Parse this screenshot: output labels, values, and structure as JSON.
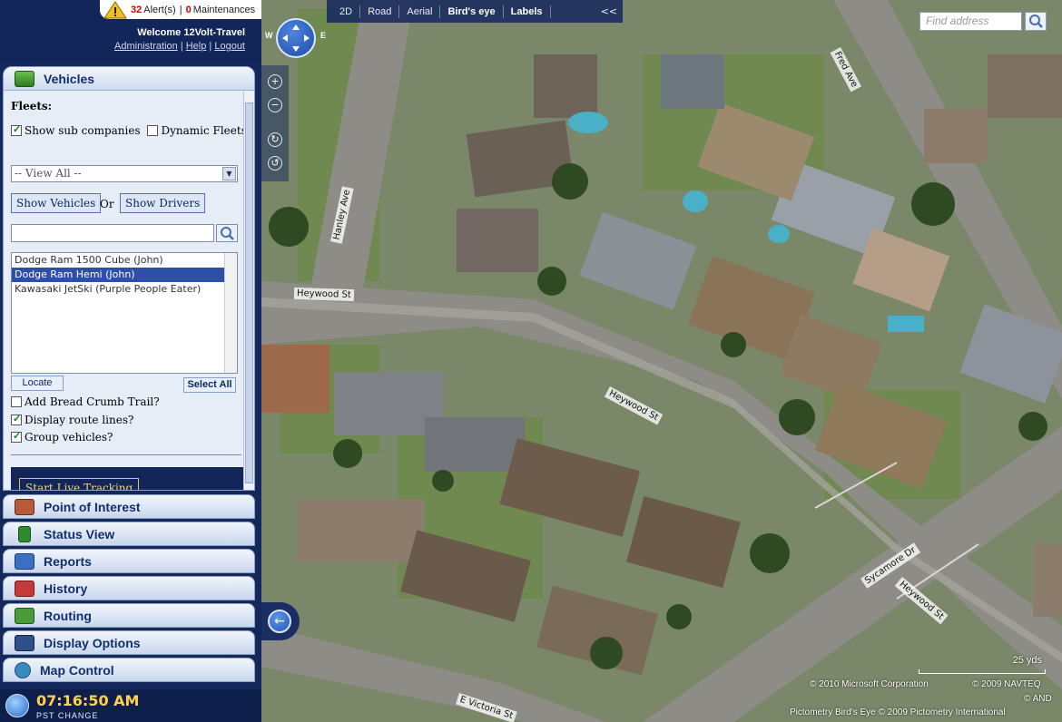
{
  "header": {
    "alert_count": "32",
    "alert_label": "Alert(s)",
    "separator": "|",
    "maintenance_count": "0",
    "maintenance_label": "Maintenances",
    "welcome": "Welcome 12Volt-Travel",
    "links": [
      "Administration",
      "Help",
      "Logout"
    ]
  },
  "vehicles_panel": {
    "title": "Vehicles",
    "fleets_label": "Fleets:",
    "show_sub_companies": {
      "label": "Show sub companies",
      "checked": true
    },
    "dynamic_fleets": {
      "label": "Dynamic Fleets",
      "checked": false
    },
    "fleet_select_value": "-- View All --",
    "show_vehicles_label": "Show Vehicles",
    "or_label": "Or",
    "show_drivers_label": "Show Drivers",
    "search_value": "",
    "vehicles": [
      {
        "name": "Dodge Ram 1500 Cube (John)",
        "selected": false
      },
      {
        "name": "Dodge Ram Hemi (John)",
        "selected": true
      },
      {
        "name": "Kawasaki JetSki (Purple People Eater)",
        "selected": false
      }
    ],
    "locate_label": "Locate",
    "select_all_label": "Select All",
    "options": [
      {
        "label": "Add Bread Crumb Trail?",
        "checked": false
      },
      {
        "label": "Display route lines?",
        "checked": true
      },
      {
        "label": "Group vehicles?",
        "checked": true
      }
    ],
    "live_tracking_label": "Start Live Tracking"
  },
  "nav_sections": [
    {
      "label": "Point of Interest",
      "icon": "house-icon",
      "color": "#b65a3a"
    },
    {
      "label": "Status View",
      "icon": "traffic-light-icon",
      "color": "#2d8a2d"
    },
    {
      "label": "Reports",
      "icon": "chart-icon",
      "color": "#3a6fc2"
    },
    {
      "label": "History",
      "icon": "calendar-icon",
      "color": "#c23a3a"
    },
    {
      "label": "Routing",
      "icon": "route-icon",
      "color": "#4a9a3a"
    },
    {
      "label": "Display Options",
      "icon": "monitor-icon",
      "color": "#2d4f8a"
    },
    {
      "label": "Map Control",
      "icon": "globe-icon",
      "color": "#3a8ac2"
    }
  ],
  "clock": {
    "time": "07:16:50 AM",
    "timezone": "PST",
    "change_label": "CHANGE"
  },
  "map": {
    "toolbar": [
      "2D",
      "Road",
      "Aerial",
      "Bird's eye",
      "Labels"
    ],
    "active_view": "Bird's eye",
    "collapse_label": "<<",
    "compass": {
      "west": "W",
      "east": "E"
    },
    "find_placeholder": "Find address",
    "scale": "25 yds",
    "copyright_1": "© 2010 Microsoft Corporation",
    "copyright_2": "© 2009 NAVTEQ",
    "copyright_3": "© AND",
    "copyright_4": "Pictometry Bird's Eye © 2009 Pictometry International",
    "streets": [
      "Hanley Ave",
      "Fred Ave",
      "Heywood St",
      "Heywood St",
      "Sycamore Dr",
      "Heywood St",
      "E Victoria St"
    ]
  },
  "colors": {
    "sidebar_bg": "#14285c",
    "accent": "#2e4fa8",
    "alert": "#d20000",
    "clock": "#ffd24a"
  }
}
